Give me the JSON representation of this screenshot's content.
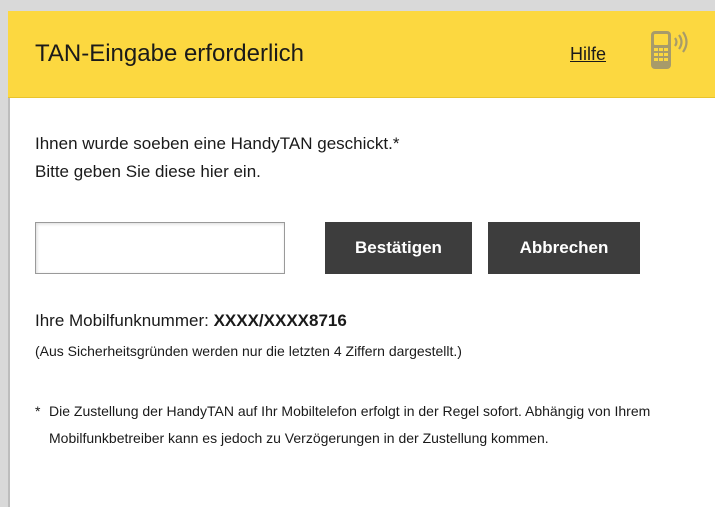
{
  "header": {
    "title": "TAN-Eingabe erforderlich",
    "help_label": "Hilfe",
    "icon": "mobile-phone-signal-icon",
    "background_color": "#fcd840"
  },
  "intro": {
    "line1": "Ihnen wurde soeben eine HandyTAN geschickt.*",
    "line2": "Bitte geben Sie diese hier ein."
  },
  "form": {
    "tan_value": "",
    "confirm_label": "Bestätigen",
    "cancel_label": "Abbrechen",
    "button_color": "#3d3d3d"
  },
  "mobile": {
    "label": "Ihre Mobilfunknummer: ",
    "number": "XXXX/XXXX8716",
    "security_note": "(Aus Sicherheitsgründen werden nur die letzten 4 Ziffern dargestellt.)"
  },
  "footnote": {
    "marker": "*",
    "text": "Die Zustellung der HandyTAN auf Ihr Mobiltelefon erfolgt in der Regel sofort. Abhängig von Ihrem Mobilfunkbetreiber kann es jedoch zu Verzögerungen in der Zustellung kommen."
  }
}
